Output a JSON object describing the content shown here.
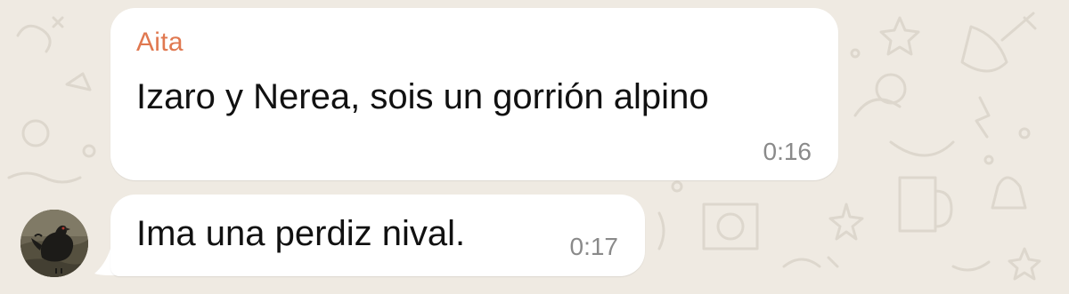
{
  "chat": {
    "messages": [
      {
        "sender": "Aita",
        "text": "Izaro y Nerea, sois un gorrión alpino",
        "time": "0:16"
      },
      {
        "text": "Ima una perdiz nival.",
        "time": "0:17"
      }
    ]
  },
  "colors": {
    "background": "#efeae2",
    "bubble": "#ffffff",
    "sender_name": "#e07850",
    "timestamp": "#8a8a8a"
  },
  "icons": {
    "avatar": "bird-photo-avatar",
    "wallpaper": "doodle-pattern"
  }
}
